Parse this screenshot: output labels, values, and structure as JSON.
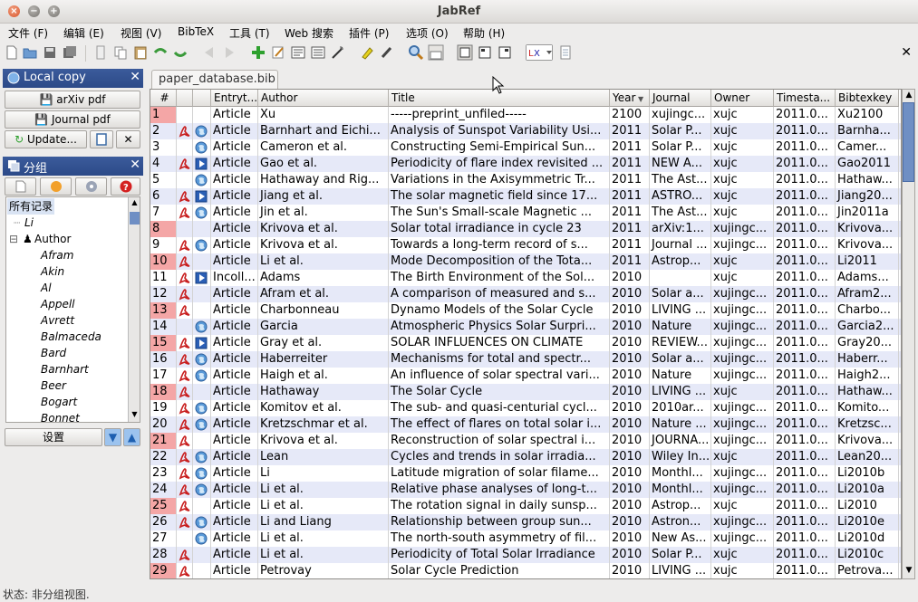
{
  "window": {
    "title": "JabRef"
  },
  "menu": [
    "文件 (F)",
    "编辑 (E)",
    "视图 (V)",
    "BibTeX",
    "工具 (T)",
    "Web 搜索",
    "插件 (P)",
    "选项 (O)",
    "帮助 (H)"
  ],
  "local_copy": {
    "title": "Local copy",
    "arxiv_label": "arXiv pdf",
    "journal_label": "Journal pdf",
    "update_label": "Update..."
  },
  "groups": {
    "title": "分组",
    "settings_label": "设置",
    "tree": {
      "all": "所有记录",
      "li": "Li",
      "author": "Author",
      "authors": [
        "Afram",
        "Akin",
        "Al",
        "Appell",
        "Avrett",
        "Balmaceda",
        "Bard",
        "Barnhart",
        "Beer",
        "Bogart",
        "Bonnet"
      ]
    }
  },
  "tab": {
    "label": "paper_database.bib"
  },
  "table": {
    "headers": [
      "#",
      "",
      "",
      "Entryt...",
      "Author",
      "Title",
      "Year",
      "Journal",
      "Owner",
      "Timesta...",
      "Bibtexkey"
    ],
    "rows": [
      [
        "1",
        "Article",
        "Xu",
        "-----preprint_unfiled-----",
        "2100",
        "xujingc...",
        "xujc",
        "2011.0...",
        "Xu2100"
      ],
      [
        "2",
        "Article",
        "Barnhart and Eichi...",
        "Analysis of Sunspot Variability Usi...",
        "2011",
        "Solar P...",
        "xujc",
        "2011.0...",
        "Barnha..."
      ],
      [
        "3",
        "Article",
        "Cameron et al.",
        "Constructing Semi-Empirical Sun...",
        "2011",
        "Solar P...",
        "xujc",
        "2011.0...",
        "Camer..."
      ],
      [
        "4",
        "Article",
        "Gao et al.",
        "Periodicity of flare index revisited ...",
        "2011",
        "NEW A...",
        "xujc",
        "2011.0...",
        "Gao2011"
      ],
      [
        "5",
        "Article",
        "Hathaway and Rig...",
        "Variations in the Axisymmetric Tr...",
        "2011",
        "The Ast...",
        "xujc",
        "2011.0...",
        "Hathaw..."
      ],
      [
        "6",
        "Article",
        "Jiang et al.",
        "The solar magnetic field since 17...",
        "2011",
        "ASTRO...",
        "xujc",
        "2011.0...",
        "Jiang20..."
      ],
      [
        "7",
        "Article",
        "Jin et al.",
        "The Sun's Small-scale Magnetic ...",
        "2011",
        "The Ast...",
        "xujc",
        "2011.0...",
        "Jin2011a"
      ],
      [
        "8",
        "Article",
        "Krivova et al.",
        "Solar total irradiance in cycle 23",
        "2011",
        "arXiv:1...",
        "xujingc...",
        "2011.0...",
        "Krivova..."
      ],
      [
        "9",
        "Article",
        "Krivova et al.",
        "Towards a long-term record of s...",
        "2011",
        "Journal ...",
        "xujingc...",
        "2011.0...",
        "Krivova..."
      ],
      [
        "10",
        "Article",
        "Li et al.",
        "Mode Decomposition of the Tota...",
        "2011",
        "Astrop...",
        "xujc",
        "2011.0...",
        "Li2011"
      ],
      [
        "11",
        "Incoll...",
        "Adams",
        "The Birth Environment of the Sol...",
        "2010",
        "",
        "xujc",
        "2011.0...",
        "Adams..."
      ],
      [
        "12",
        "Article",
        "Afram et al.",
        "A comparison of measured and s...",
        "2010",
        "Solar a...",
        "xujingc...",
        "2011.0...",
        "Afram2..."
      ],
      [
        "13",
        "Article",
        "Charbonneau",
        "Dynamo Models of the Solar Cycle",
        "2010",
        "LIVING ...",
        "xujingc...",
        "2011.0...",
        "Charbo..."
      ],
      [
        "14",
        "Article",
        "Garcia",
        "Atmospheric Physics Solar Surpri...",
        "2010",
        "Nature",
        "xujingc...",
        "2011.0...",
        "Garcia2..."
      ],
      [
        "15",
        "Article",
        "Gray et al.",
        "SOLAR INFLUENCES ON CLIMATE",
        "2010",
        "REVIEW...",
        "xujingc...",
        "2011.0...",
        "Gray20..."
      ],
      [
        "16",
        "Article",
        "Haberreiter",
        "Mechanisms for total and spectr...",
        "2010",
        "Solar a...",
        "xujingc...",
        "2011.0...",
        "Haberr..."
      ],
      [
        "17",
        "Article",
        "Haigh et al.",
        "An influence of solar spectral vari...",
        "2010",
        "Nature",
        "xujingc...",
        "2011.0...",
        "Haigh2..."
      ],
      [
        "18",
        "Article",
        "Hathaway",
        "The Solar Cycle",
        "2010",
        "LIVING ...",
        "xujc",
        "2011.0...",
        "Hathaw..."
      ],
      [
        "19",
        "Article",
        "Komitov et al.",
        "The sub- and quasi-centurial cycl...",
        "2010",
        "2010ar...",
        "xujingc...",
        "2011.0...",
        "Komito..."
      ],
      [
        "20",
        "Article",
        "Kretzschmar et al.",
        "The effect of flares on total solar i...",
        "2010",
        "Nature ...",
        "xujingc...",
        "2011.0...",
        "Kretzsc..."
      ],
      [
        "21",
        "Article",
        "Krivova et al.",
        "Reconstruction of solar spectral i...",
        "2010",
        "JOURNA...",
        "xujingc...",
        "2011.0...",
        "Krivova..."
      ],
      [
        "22",
        "Article",
        "Lean",
        "Cycles and trends in solar irradia...",
        "2010",
        "Wiley In...",
        "xujc",
        "2011.0...",
        "Lean20..."
      ],
      [
        "23",
        "Article",
        "Li",
        "Latitude migration of solar filame...",
        "2010",
        "Monthl...",
        "xujingc...",
        "2011.0...",
        "Li2010b"
      ],
      [
        "24",
        "Article",
        "Li et al.",
        "Relative phase analyses of long-t...",
        "2010",
        "Monthl...",
        "xujingc...",
        "2011.0...",
        "Li2010a"
      ],
      [
        "25",
        "Article",
        "Li et al.",
        "The rotation signal in daily sunsp...",
        "2010",
        "Astrop...",
        "xujc",
        "2011.0...",
        "Li2010"
      ],
      [
        "26",
        "Article",
        "Li and Liang",
        "Relationship between group sun...",
        "2010",
        "Astron...",
        "xujingc...",
        "2011.0...",
        "Li2010e"
      ],
      [
        "27",
        "Article",
        "Li et al.",
        "The north-south asymmetry of fil...",
        "2010",
        "New As...",
        "xujingc...",
        "2011.0...",
        "Li2010d"
      ],
      [
        "28",
        "Article",
        "Li et al.",
        "Periodicity of Total Solar Irradiance",
        "2010",
        "Solar P...",
        "xujc",
        "2011.0...",
        "Li2010c"
      ],
      [
        "29",
        "Article",
        "Petrovay",
        "Solar Cycle Prediction",
        "2010",
        "LIVING ...",
        "xujc",
        "2011.0...",
        "Petrova..."
      ]
    ],
    "pink_rows": [
      1,
      8,
      10,
      13,
      15,
      18,
      21,
      25,
      29
    ],
    "pdf_rows": [
      2,
      4,
      6,
      7,
      9,
      10,
      11,
      12,
      13,
      15,
      16,
      17,
      18,
      19,
      20,
      21,
      22,
      23,
      24,
      25,
      26,
      28,
      29
    ],
    "globe_rows": [
      2,
      3,
      5,
      7,
      9,
      14,
      16,
      17,
      19,
      20,
      22,
      23,
      24,
      26,
      27
    ],
    "link_rows": [
      4,
      6,
      11,
      15
    ]
  },
  "status": {
    "text": "状态: 非分组视图."
  },
  "colors": {
    "selection": "#3c68b6",
    "pink": "#f4a6a6",
    "row_alt": "#e6e9f8"
  }
}
